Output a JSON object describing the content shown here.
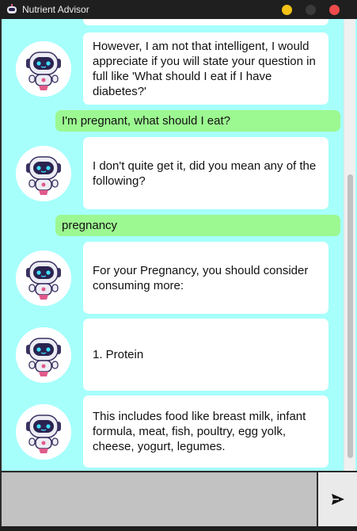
{
  "window": {
    "title": "Nutrient Advisor",
    "buttons": [
      "minimize",
      "maximize",
      "close"
    ]
  },
  "colors": {
    "chat_background": "#a6fffb",
    "bot_bubble": "#ffffff",
    "user_bubble": "#9cf891",
    "input_background": "#c2c2c2"
  },
  "messages": [
    {
      "sender": "bot",
      "text": "However, I am not that intelligent, I would appreciate if you will state your question in full like 'What should I eat if I have diabetes?'"
    },
    {
      "sender": "user",
      "text": "I'm pregnant, what should I eat?"
    },
    {
      "sender": "bot",
      "text": "I don't quite get it, did you mean any of the following?"
    },
    {
      "sender": "user",
      "text": "pregnancy"
    },
    {
      "sender": "bot",
      "text": "For your Pregnancy, you should consider consuming more:"
    },
    {
      "sender": "bot",
      "text": "1. Protein"
    },
    {
      "sender": "bot",
      "text": "This includes food like breast milk, infant formula, meat, fish, poultry, egg yolk, cheese, yogurt, legumes."
    }
  ],
  "input": {
    "value": "",
    "placeholder": ""
  },
  "icons": {
    "send": "send-icon",
    "avatar": "robot-avatar-icon"
  }
}
